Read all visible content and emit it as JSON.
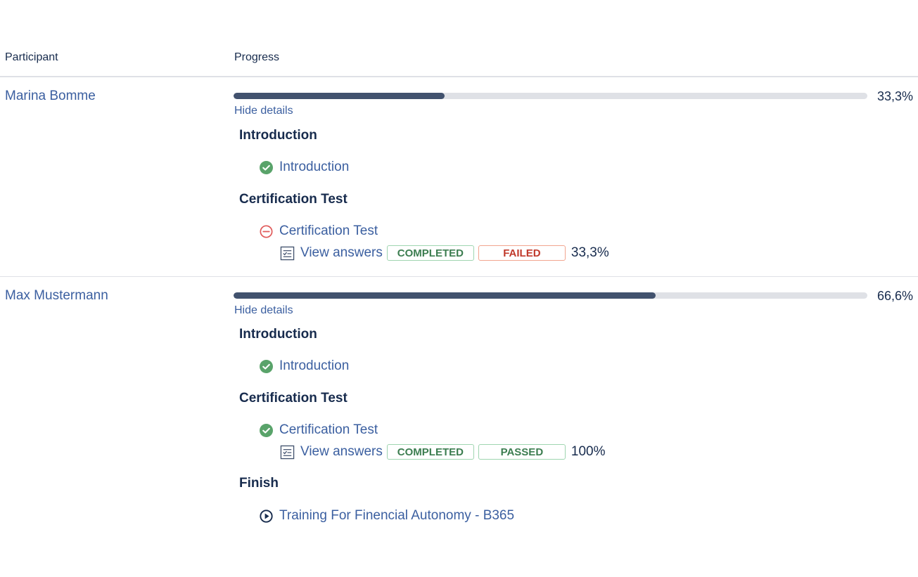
{
  "header": {
    "participant": "Participant",
    "progress": "Progress"
  },
  "colors": {
    "accent": "#3b5fa0",
    "progress_fill": "#42526e",
    "success": "#59a36a",
    "danger": "#e05a5a"
  },
  "participants": [
    {
      "name": "Marina Bomme",
      "progress_fraction": 0.333,
      "progress_text": "33,3%",
      "toggle_label": "Hide details",
      "sections": [
        {
          "title": "Introduction",
          "items": [
            {
              "label": "Introduction",
              "status_icon": "check-circle-icon"
            }
          ]
        },
        {
          "title": "Certification Test",
          "items": [
            {
              "label": "Certification Test",
              "status_icon": "minus-circle-icon",
              "answers": {
                "link": "View answers",
                "state": "COMPLETED",
                "result": "FAILED",
                "score": "33,3%"
              }
            }
          ]
        }
      ]
    },
    {
      "name": "Max Mustermann",
      "progress_fraction": 0.666,
      "progress_text": "66,6%",
      "toggle_label": "Hide details",
      "sections": [
        {
          "title": "Introduction",
          "items": [
            {
              "label": "Introduction",
              "status_icon": "check-circle-icon"
            }
          ]
        },
        {
          "title": "Certification Test",
          "items": [
            {
              "label": "Certification Test",
              "status_icon": "check-circle-icon",
              "answers": {
                "link": "View answers",
                "state": "COMPLETED",
                "result": "PASSED",
                "score": "100%"
              }
            }
          ]
        },
        {
          "title": "Finish",
          "items": [
            {
              "label": "Training For Finencial Autonomy - B365",
              "status_icon": "play-circle-icon"
            }
          ]
        }
      ]
    }
  ]
}
